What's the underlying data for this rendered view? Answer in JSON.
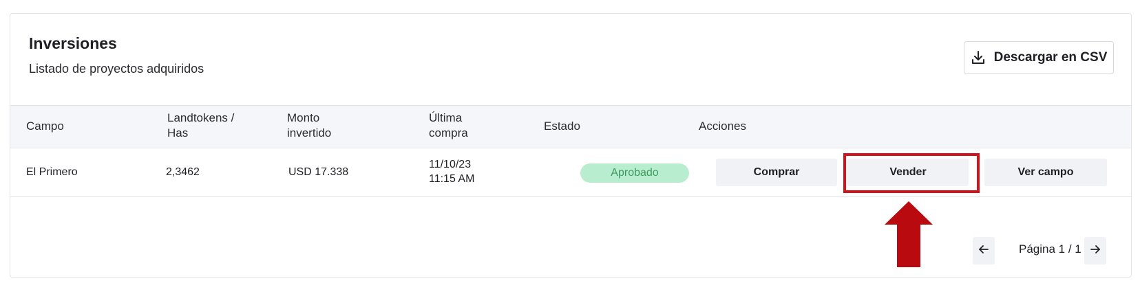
{
  "card": {
    "title": "Inversiones",
    "subtitle": "Listado de proyectos adquiridos",
    "csv_button": {
      "label": "Descargar en CSV",
      "icon": "download-icon"
    }
  },
  "table": {
    "headers": {
      "campo": "Campo",
      "landtokens_1": "Landtokens /",
      "landtokens_2": "Has",
      "monto_1": "Monto",
      "monto_2": "invertido",
      "ultima_1": "Última",
      "ultima_2": "compra",
      "estado": "Estado",
      "acciones": "Acciones"
    },
    "rows": [
      {
        "campo": "El Primero",
        "landtokens": "2,3462",
        "monto": "USD 17.338",
        "fecha": "11/10/23",
        "hora": "11:15 AM",
        "estado": "Aprobado",
        "acciones": {
          "comprar": "Comprar",
          "vender": "Vender",
          "ver": "Ver campo"
        }
      }
    ]
  },
  "pagination": {
    "label": "Página 1 / 1",
    "prev_icon": "arrow-left-icon",
    "next_icon": "arrow-right-icon"
  },
  "annotation": {
    "color": "#d0141b",
    "target": "Vender",
    "arrow_icon": "arrow-up-icon"
  },
  "colors": {
    "status_badge_bg": "#b9edcf",
    "status_badge_text": "#3d9a5e",
    "header_bg": "#f5f6f9"
  }
}
